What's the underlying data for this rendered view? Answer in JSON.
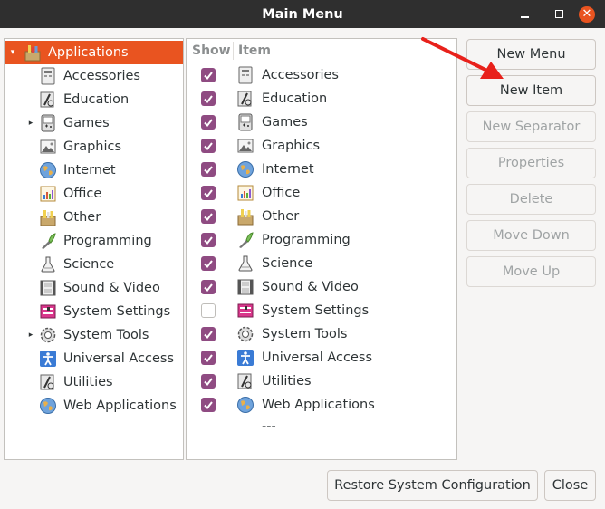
{
  "window": {
    "title": "Main Menu"
  },
  "left_tree": {
    "root": {
      "label": "Applications",
      "expander": "▾"
    },
    "items": [
      {
        "label": "Accessories",
        "icon": "accessories-icon"
      },
      {
        "label": "Education",
        "icon": "education-icon"
      },
      {
        "label": "Games",
        "icon": "games-icon",
        "expander": "▸"
      },
      {
        "label": "Graphics",
        "icon": "graphics-icon"
      },
      {
        "label": "Internet",
        "icon": "internet-icon"
      },
      {
        "label": "Office",
        "icon": "office-icon"
      },
      {
        "label": "Other",
        "icon": "other-icon"
      },
      {
        "label": "Programming",
        "icon": "programming-icon"
      },
      {
        "label": "Science",
        "icon": "science-icon"
      },
      {
        "label": "Sound & Video",
        "icon": "sound-video-icon"
      },
      {
        "label": "System Settings",
        "icon": "system-settings-icon"
      },
      {
        "label": "System Tools",
        "icon": "system-tools-icon",
        "expander": "▸"
      },
      {
        "label": "Universal Access",
        "icon": "universal-access-icon"
      },
      {
        "label": "Utilities",
        "icon": "utilities-icon"
      },
      {
        "label": "Web Applications",
        "icon": "web-applications-icon"
      }
    ]
  },
  "item_list": {
    "columns": {
      "show": "Show",
      "item": "Item"
    },
    "rows": [
      {
        "label": "Accessories",
        "show": true
      },
      {
        "label": "Education",
        "show": true
      },
      {
        "label": "Games",
        "show": true
      },
      {
        "label": "Graphics",
        "show": true
      },
      {
        "label": "Internet",
        "show": true
      },
      {
        "label": "Office",
        "show": true
      },
      {
        "label": "Other",
        "show": true
      },
      {
        "label": "Programming",
        "show": true
      },
      {
        "label": "Science",
        "show": true
      },
      {
        "label": "Sound & Video",
        "show": true
      },
      {
        "label": "System Settings",
        "show": false
      },
      {
        "label": "System Tools",
        "show": true
      },
      {
        "label": "Universal Access",
        "show": true
      },
      {
        "label": "Utilities",
        "show": true
      },
      {
        "label": "Web Applications",
        "show": true
      }
    ],
    "separator_label": "---"
  },
  "buttons": {
    "new_menu": "New Menu",
    "new_item": "New Item",
    "new_separator": "New Separator",
    "properties": "Properties",
    "delete": "Delete",
    "move_down": "Move Down",
    "move_up": "Move Up",
    "restore": "Restore System Configuration",
    "close": "Close"
  },
  "colors": {
    "accent": "#e95420",
    "checkbox": "#8f4b82",
    "titlebar": "#2f2f2f",
    "annotation_arrow": "#e8211b"
  }
}
